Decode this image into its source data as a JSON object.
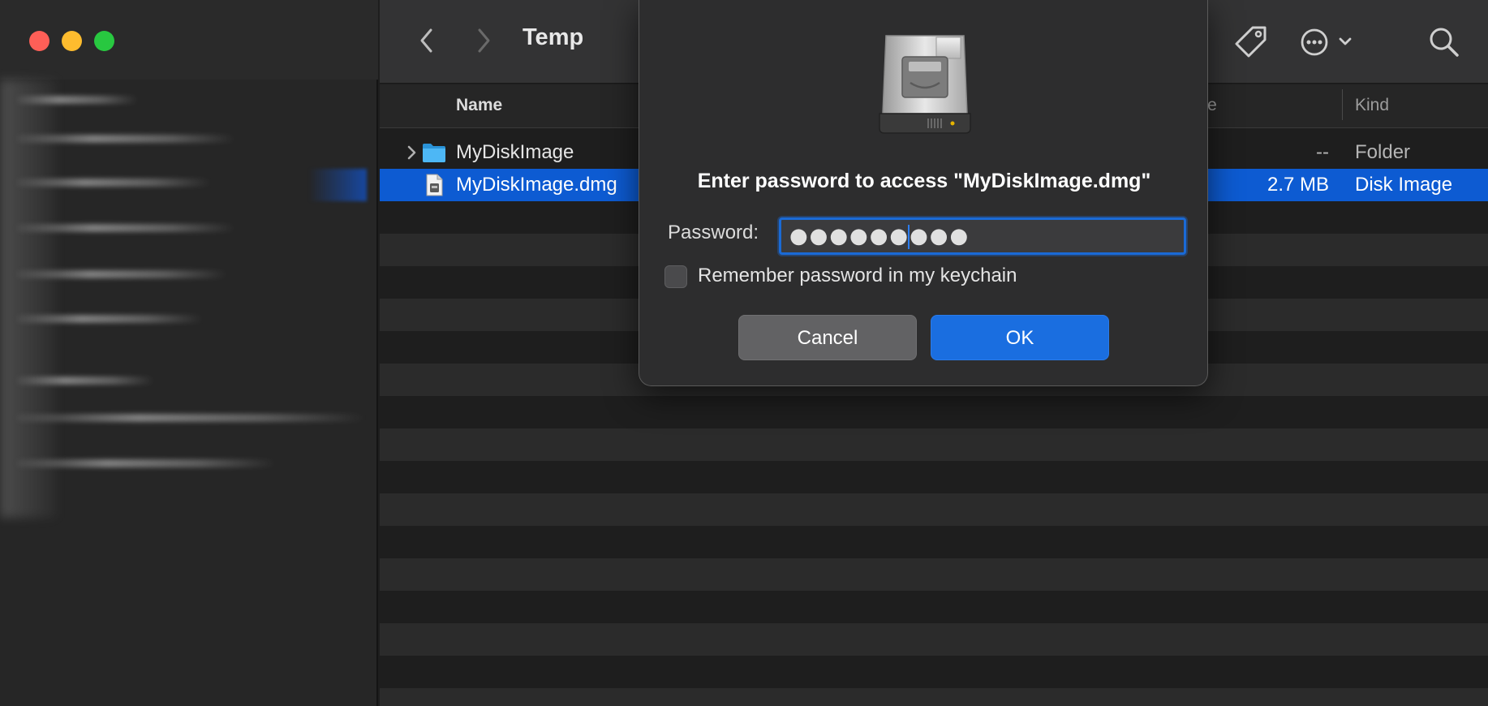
{
  "window": {
    "title": "Temp",
    "traffic_lights": [
      "close",
      "minimize",
      "zoom"
    ]
  },
  "toolbar": {
    "back_icon": "chevron-left-icon",
    "forward_icon": "chevron-right-icon",
    "tag_icon": "tag-icon",
    "more_icon": "ellipsis-circle-icon",
    "search_icon": "magnifier-icon"
  },
  "columns": {
    "name": "Name",
    "size": "ize",
    "kind": "Kind"
  },
  "files": [
    {
      "name": "MyDiskImage",
      "size": "--",
      "kind": "Folder",
      "icon": "folder-icon",
      "expandable": true,
      "selected": false
    },
    {
      "name": "MyDiskImage.dmg",
      "size": "2.7 MB",
      "kind": "Disk Image",
      "icon": "disk-image-file-icon",
      "expandable": false,
      "selected": true
    }
  ],
  "dialog": {
    "icon": "hard-drive-icon",
    "message": "Enter password to access \"MyDiskImage.dmg\"",
    "password_label": "Password:",
    "password_masked": "●●●●●●●●●",
    "remember_label": "Remember password in my keychain",
    "remember_checked": false,
    "cancel_label": "Cancel",
    "ok_label": "OK"
  },
  "colors": {
    "accent": "#1a6ee0",
    "selection": "#0d5bd2",
    "close": "#fe5f57",
    "minimize": "#febc2e",
    "zoom": "#28c840",
    "folder": "#35aaf0"
  }
}
